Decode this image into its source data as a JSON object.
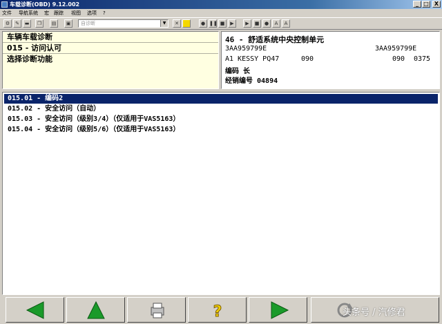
{
  "window": {
    "title": "车载诊断(OBD) 9.12.002",
    "minimize": "_",
    "maximize": "□",
    "close": "X"
  },
  "menu": {
    "items": [
      "文件",
      "导航系统",
      "宏",
      "跟踪",
      "视图",
      "选项",
      "?"
    ]
  },
  "toolbar": {
    "combo_value": "自诊断"
  },
  "info_left": {
    "rows": [
      "车辆车载诊断",
      "015 - 访问认可",
      "选择诊断功能"
    ]
  },
  "info_right": {
    "controller": "46 - 舒适系统中央控制单元",
    "part_left": "3AA959799E",
    "part_right": "3AA959799E",
    "component": "A1 KESSY PQ47",
    "component_code": "090",
    "version_a": "090",
    "version_b": "0375",
    "coding": "编码 长",
    "dealer": "经销编号 04894"
  },
  "functions": {
    "items": [
      "015.01 - 编码2",
      "015.02 - 安全访问（自动）",
      "015.03 - 安全访问（级别3/4）（仅适用于VAS5163）",
      "015.04 - 安全访问（级别5/6）（仅适用于VAS5163）"
    ],
    "selected_index": 0
  },
  "bottom_buttons": {
    "icons": [
      "back-arrow-icon",
      "up-arrow-icon",
      "printer-icon",
      "help-icon",
      "forward-arrow-icon",
      "refresh-icon"
    ]
  },
  "colors": {
    "selection": "#0a246a",
    "arrow_green": "#1a9a2a",
    "help_yellow": "#f0d000",
    "info_bg": "#ffffe1"
  },
  "watermark": "头条号 / 汽修君"
}
